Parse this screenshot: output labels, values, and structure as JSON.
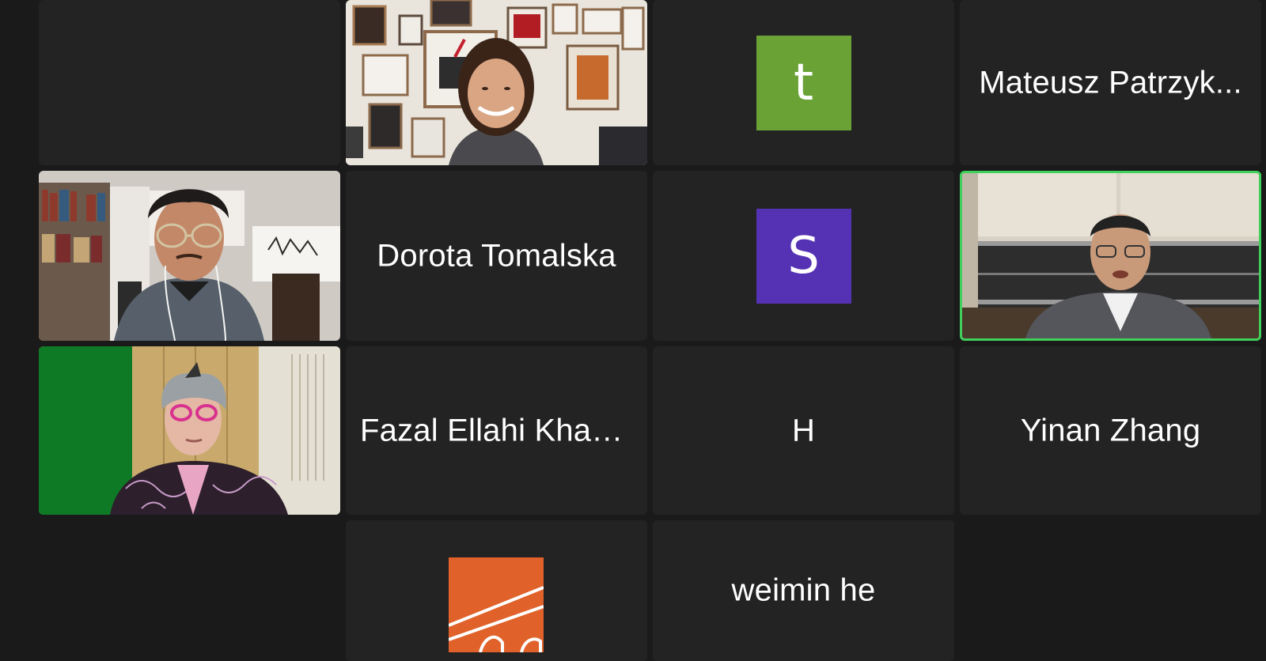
{
  "meeting": {
    "tiles": [
      {
        "kind": "empty"
      },
      {
        "kind": "video",
        "subject": "woman-gallery-wall"
      },
      {
        "kind": "avatar",
        "letter": "t",
        "color": "#6aa236"
      },
      {
        "kind": "name",
        "label": "Mateusz Patrzyk..."
      },
      {
        "kind": "video",
        "subject": "man-glasses-bookshelf"
      },
      {
        "kind": "name",
        "label": "Dorota Tomalska"
      },
      {
        "kind": "avatar",
        "letter": "S",
        "color": "#5531b4"
      },
      {
        "kind": "video",
        "subject": "man-suit-speaking",
        "active": true
      },
      {
        "kind": "video",
        "subject": "woman-pink-glasses"
      },
      {
        "kind": "name",
        "label": "Fazal Ellahi Khan..."
      },
      {
        "kind": "name",
        "label": "H"
      },
      {
        "kind": "name",
        "label": "Yinan Zhang"
      },
      {
        "kind": "empty"
      },
      {
        "kind": "logo",
        "color": "#e0612a"
      },
      {
        "kind": "name",
        "label": "weimin he"
      },
      {
        "kind": "empty"
      }
    ]
  },
  "colors": {
    "background": "#1a1a1a",
    "tile": "#232323",
    "active_speaker_border": "#3fd15a",
    "text": "#ffffff"
  }
}
